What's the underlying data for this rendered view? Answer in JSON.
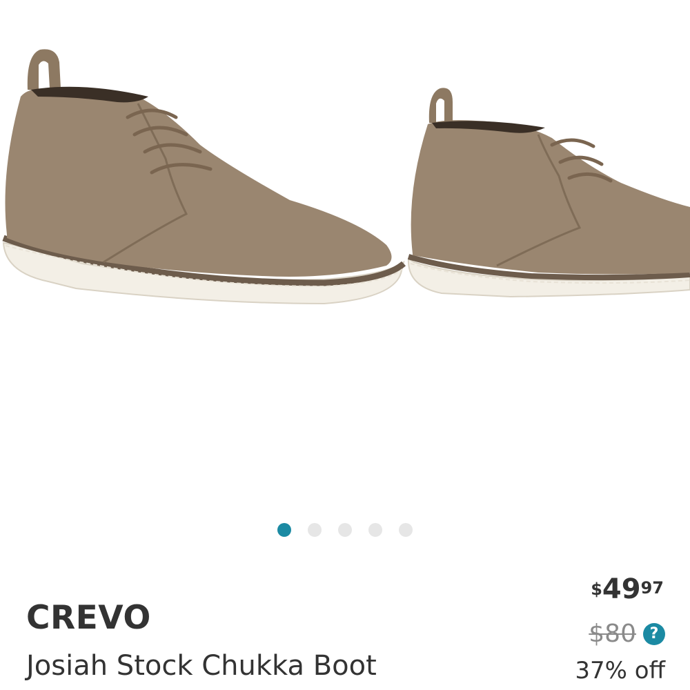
{
  "carousel": {
    "images": [
      {
        "icon": "boot-side-view-image"
      },
      {
        "icon": "boot-side-view-image-2"
      }
    ],
    "dots": [
      {
        "active": true
      },
      {
        "active": false
      },
      {
        "active": false
      },
      {
        "active": false
      },
      {
        "active": false
      }
    ]
  },
  "product": {
    "brand": "CREVO",
    "name": "Josiah Stock Chukka Boot"
  },
  "pricing": {
    "currency_symbol": "$",
    "price_dollars": "49",
    "price_cents": "97",
    "original_price": "$80",
    "help_label": "?",
    "discount_text": "37% off"
  },
  "colors": {
    "accent": "#1b8aa3",
    "suede": "#9a8670",
    "sole": "#f3efe6"
  }
}
